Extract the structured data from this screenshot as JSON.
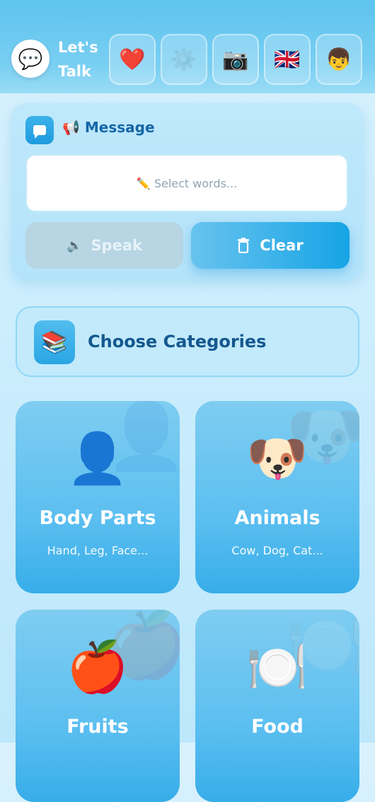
{
  "header": {
    "title": "Let's Talk",
    "logo_icon": "💬",
    "buttons": [
      {
        "name": "favorites",
        "icon": "❤️"
      },
      {
        "name": "settings",
        "icon": "⚙️"
      },
      {
        "name": "camera",
        "icon": "📷"
      },
      {
        "name": "language",
        "icon": "🇬🇧"
      },
      {
        "name": "profile",
        "icon": "👦"
      }
    ]
  },
  "message": {
    "title_icon": "📢",
    "title": "Message",
    "placeholder": "✏️ Select words...",
    "speak_icon": "🔈",
    "speak_label": "Speak",
    "clear_label": "Clear"
  },
  "categories": {
    "header_icon": "📚",
    "header_title": "Choose Categories",
    "items": [
      {
        "icon": "👤",
        "name": "Body Parts",
        "examples": "Hand, Leg, Face..."
      },
      {
        "icon": "🐶",
        "name": "Animals",
        "examples": "Cow, Dog, Cat..."
      },
      {
        "icon": "🍎",
        "name": "Fruits",
        "examples": ""
      },
      {
        "icon": "🍽️",
        "name": "Food",
        "examples": ""
      }
    ]
  },
  "colors": {
    "header": "#5ec3ee",
    "accent": "#16a4e6",
    "title_text": "#14588f",
    "disabled": "#b7d5e3"
  }
}
